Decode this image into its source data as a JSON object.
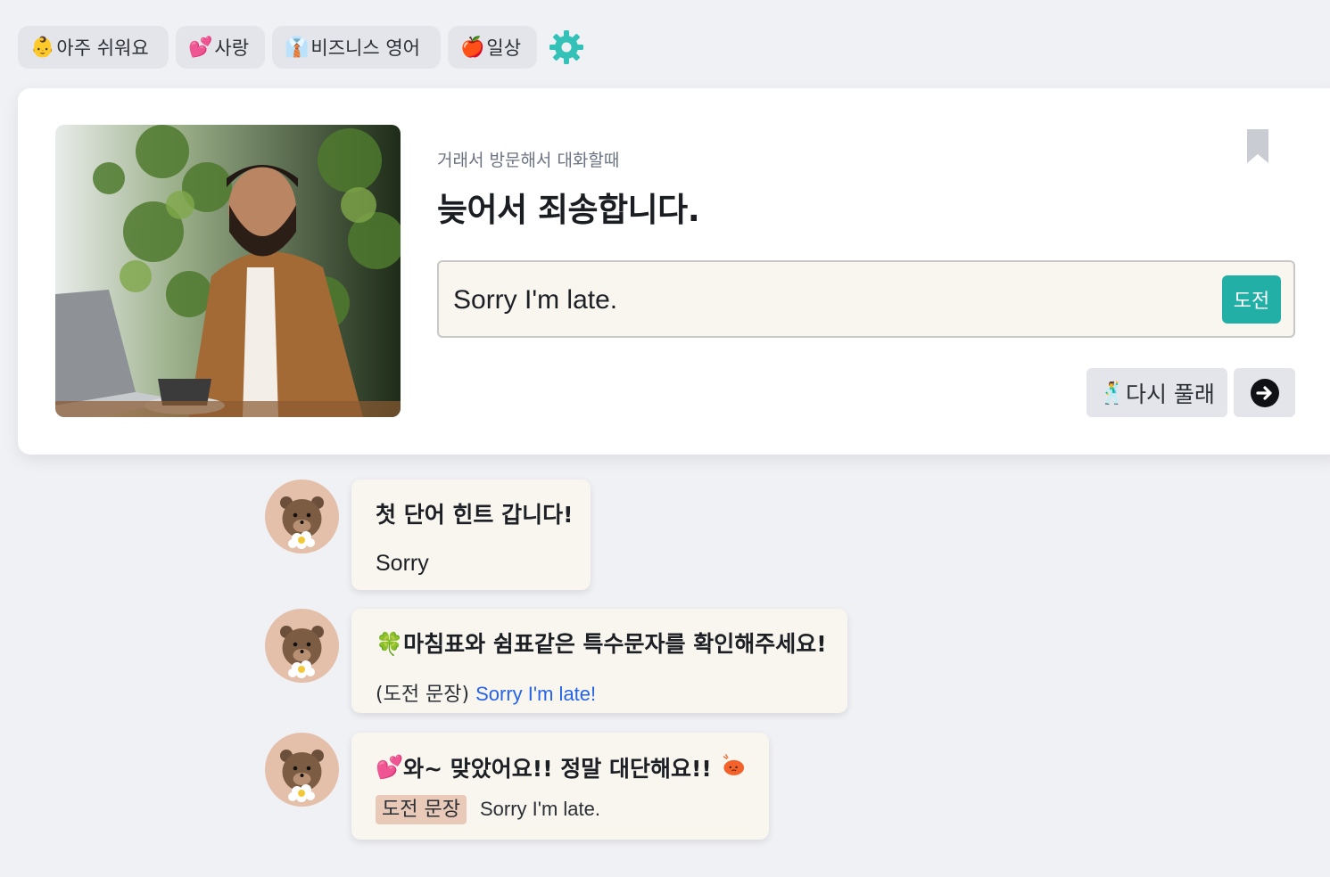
{
  "topics": [
    {
      "emoji": "👶",
      "label": "아주 쉬워요"
    },
    {
      "emoji": "💕",
      "label": "사랑"
    },
    {
      "emoji": "👔",
      "label": "비즈니스 영어"
    },
    {
      "emoji": "🍎",
      "label": "일상"
    }
  ],
  "colors": {
    "accent": "#22b0a6",
    "link": "#2563eb",
    "bubble": "#f9f6ef",
    "chip": "#e3e5ea"
  },
  "icons": {
    "settings": "gear-icon",
    "bookmark": "bookmark-icon",
    "next": "arrow-right-circle-icon"
  },
  "card": {
    "context": "거래서 방문해서 대화할때",
    "question": "늦어서 죄송합니다.",
    "answer_value": "Sorry I'm late.",
    "challenge_label": "도전",
    "retry_emoji": "🕺",
    "retry_label": "다시 풀래"
  },
  "messages": [
    {
      "title": "첫 단어 힌트 갑니다!",
      "hint": "Sorry"
    },
    {
      "emoji": "🍀",
      "title": "마침표와 쉼표같은 특수문자를 확인해주세요!",
      "prefix": "(도전 문장)",
      "sentence": "Sorry I'm late!"
    },
    {
      "emoji": "💕",
      "title": "와~ 맞았어요!! 정말 대단해요!!",
      "tag": "도전 문장",
      "sentence": "Sorry I'm late."
    }
  ]
}
